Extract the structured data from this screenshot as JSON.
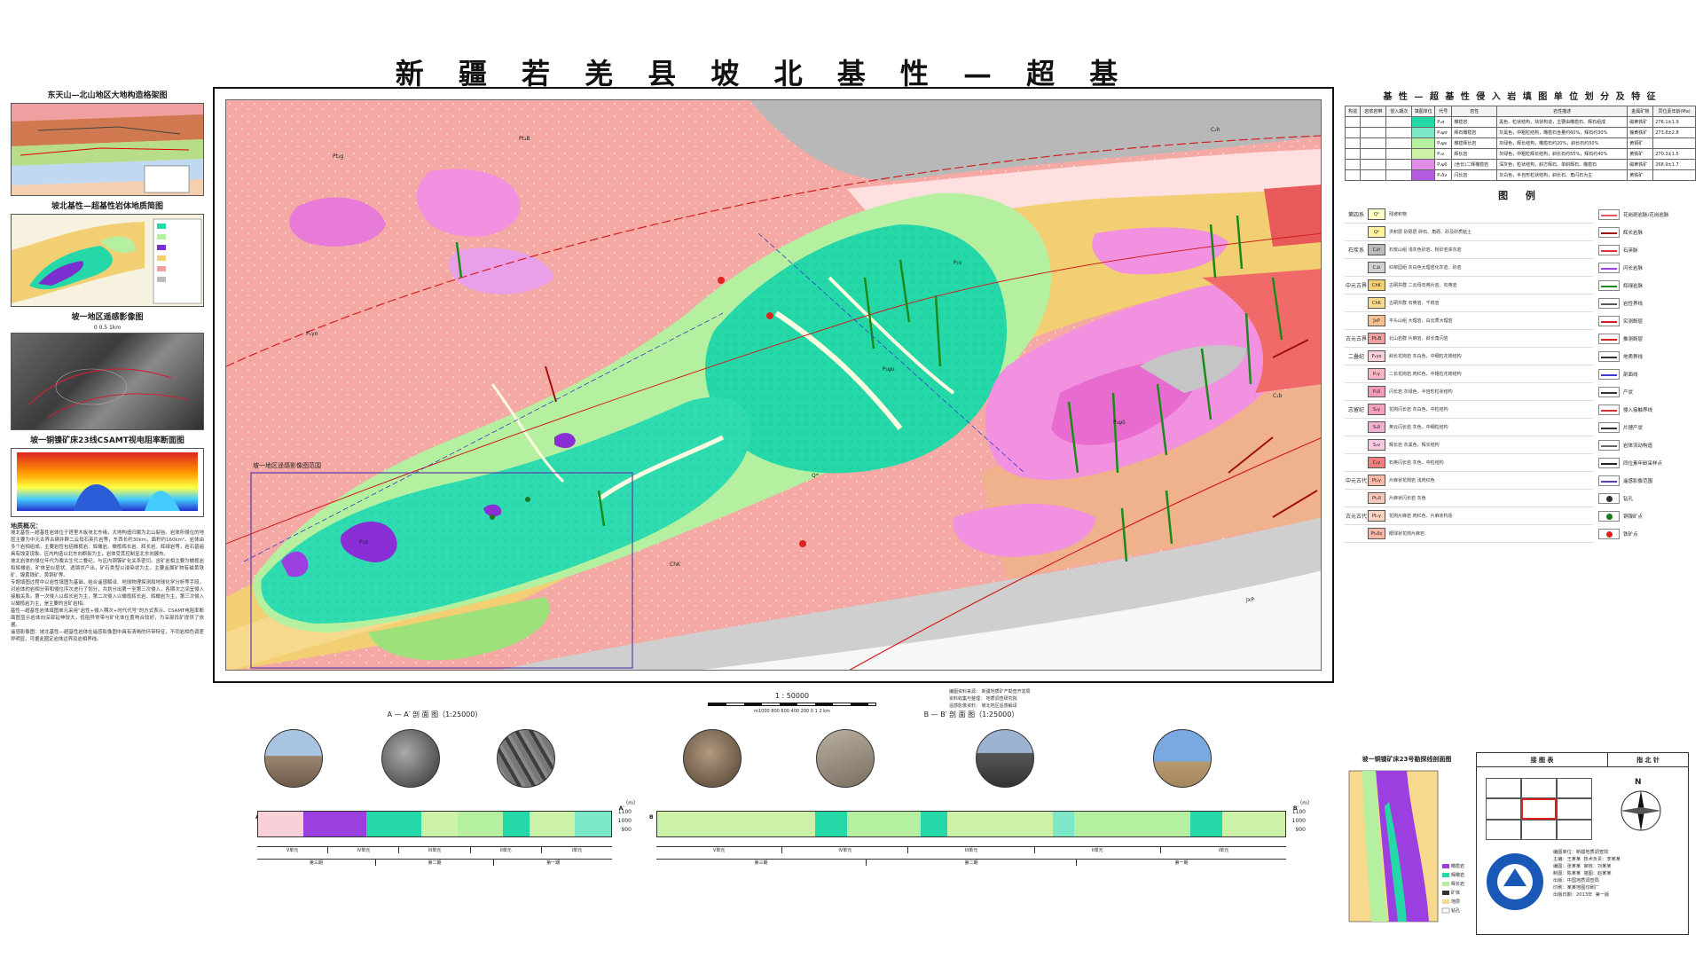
{
  "title": "新 疆 若 羌 县 坡 北 基 性 — 超 基 性 岩 体 地 质 图",
  "left": {
    "inset1_title": "东天山—北山地区大地构造格架图",
    "inset2_title": "坡北基性—超基性岩体地质简图",
    "inset3_title": "坡一地区遥感影像图",
    "inset3_scale": "0    0.5    1km",
    "inset4_title": "坡一铜镍矿床23线CSAMT视电阻率断面图",
    "notes_title": "地质概况：",
    "notes": "坡北基性—超基性岩体位于塔里木板块北东缘，大地构造归属为北山裂谷。岩体所侵位的地层主要为中元古界古硐井群二云母石英片岩等，东西长约30km，面积约160km²。岩体由多个岩相组成，主要岩性包括橄榄岩、辉橄岩、橄榄辉长岩、辉长岩、辉绿岩等，岩石普遍具有蚀变现象。区内构造以北东向断裂为主，岩体受其控制呈北东向展布。\n坡北岩体的侵位年代为晚古生代二叠纪，与区内铜镍矿化关系密切。含矿岩相主要为橄榄岩和辉橄岩，矿体呈似层状、透镜状产出，矿石类型以浸染状为主，主要金属矿物有磁黄铁矿、镍黄铁矿、黄铜矿等。\n专题填图过程中以岩性填图为基础，结合遥感解译、地球物理探测和地球化学分析等手段，对岩体的岩相分带和侵位序次进行了划分，共划分出第一至第三次侵入，各期次之间呈侵入接触关系。第一次侵入以辉长岩为主，第二次侵入以橄榄辉长岩、辉橄岩为主，第三次侵入以橄榄岩为主，是主要的含矿岩相。\n基性—超基性岩体填图单元采用“岩性+侵入期次+时代代号”的方式表示。CSAMT电阻率断面图显示岩体向深部延伸较大，低阻异常带与矿化体位置吻合较好，为深部找矿提供了依据。\n遥感影像图：坡北基性—超基性岩体在遥感影像图中具有清晰的环带特征，不同岩相色调差异明显，可据此圈定岩体边界及岩相界线。"
  },
  "map": {
    "rs_box_label": "坡一地区遥感影像图范围",
    "grid_left": [
      "",
      "",
      "",
      "",
      "",
      ""
    ],
    "labels": [
      {
        "t": "Pt₂g",
        "c": "#333"
      },
      {
        "t": "P₁γo",
        "c": "#333"
      },
      {
        "t": "C₂h",
        "c": "#333"
      },
      {
        "t": "Pt₁B",
        "c": "#333"
      },
      {
        "t": "ChK",
        "c": "#333"
      },
      {
        "t": "P₁ψδ",
        "c": "#333"
      },
      {
        "t": "P₁ψυ",
        "c": "#333"
      },
      {
        "t": "JxP",
        "c": "#333"
      },
      {
        "t": "Qᵃˡ",
        "c": "#333"
      },
      {
        "t": "C₁b",
        "c": "#333"
      },
      {
        "t": "P₁σ",
        "c": "#333"
      },
      {
        "t": "P₁ν",
        "c": "#333"
      }
    ]
  },
  "scale": {
    "ratio": "1 : 50000",
    "bar": "m1000  800  600  400  200    0              1               2 km"
  },
  "credits": [
    "编图资料来源：  新疆地质矿产勘查开发局",
    "资料收集与整理：  地质调查研究院",
    "遥感影像资料：  坡北地区遥感解译"
  ],
  "section_a": {
    "title": "A — A′ 剖 面 图（1:25000）",
    "left_mark": "A",
    "right_mark": "A′",
    "elev": [
      "1100",
      "1000",
      "900"
    ],
    "unit": "（m）",
    "bar_labels": [
      "V单元",
      "IV单元",
      "III单元",
      "II单元",
      "I单元",
      "第三期",
      "第二期",
      "第一期"
    ]
  },
  "section_b": {
    "title": "B — B′ 剖 面 图（1:25000）",
    "left_mark": "B",
    "right_mark": "B′",
    "elev": [
      "1100",
      "1000",
      "900"
    ],
    "unit": "（m）",
    "bar_labels": [
      "V单元",
      "IV单元",
      "III单元",
      "II单元",
      "I单元",
      "第三期",
      "第二期",
      "第一期"
    ]
  },
  "right": {
    "table_title": "基 性 — 超 基 性 侵 入 岩 填 图 单 位 划 分 及 特 征",
    "table_headers": [
      "构造",
      "岩浆岩带",
      "侵入期次",
      "填图单位",
      "代号",
      "岩性",
      "岩性描述",
      "金属矿物",
      "同位素年龄(Ma)"
    ],
    "table_rows": [
      {
        "code": "P₁σ",
        "rock": "橄榄岩",
        "desc": "黑色、粒状结构，块状构造，主要由橄榄石、辉石组成",
        "ore": "磁黄铁矿",
        "age": "276.1±1.9",
        "color": "#25d8a8"
      },
      {
        "code": "P₁ψσ",
        "rock": "辉石橄榄岩",
        "desc": "灰黑色，中粗粒结构，橄榄石含量约60%，辉石约30%",
        "ore": "镍黄铁矿",
        "age": "273.8±2.8",
        "color": "#7ce8c8"
      },
      {
        "code": "P₁ψυ",
        "rock": "橄榄辉长岩",
        "desc": "灰绿色，辉长结构，橄榄石约20%，斜长石约50%",
        "ore": "黄铜矿",
        "age": "",
        "color": "#b5f0a0"
      },
      {
        "code": "P₁ν",
        "rock": "辉长岩",
        "desc": "灰绿色，中粗粒辉长结构，斜长石约55%，辉石约40%",
        "ore": "黄铁矿",
        "age": "270.3±1.5",
        "color": "#ccf2a8"
      },
      {
        "code": "P₁ψδ",
        "rock": "(含长)二辉橄榄岩",
        "desc": "深灰色，粒状结构，斜方辉石、单斜辉石、橄榄石",
        "ore": "磁黄铁矿",
        "age": "268.9±1.7",
        "color": "#e18de8"
      },
      {
        "code": "P₁δν",
        "rock": "闪长岩",
        "desc": "灰白色，半自形粒状结构，斜长石、角闪石为主",
        "ore": "黄铁矿",
        "age": "",
        "color": "#b45ae0"
      }
    ],
    "legend_title": "图 例",
    "legend": [
      {
        "era": "第四系",
        "code": "Qʰ",
        "color": "#ffffc8",
        "txt": "残坡积物"
      },
      {
        "era": "",
        "code": "Qᵖ",
        "color": "#fff3a0",
        "txt": "洪积层 砂砾层 碎石、角砾、砂及砂质粘土"
      },
      {
        "era": "石炭系",
        "code": "C₂h",
        "color": "#bbbbbb",
        "txt": "石炭山组  浅灰色砂岩、粉砂岩夹灰岩"
      },
      {
        "era": "",
        "code": "C₁b",
        "color": "#d0d0d0",
        "txt": "红柳园组  灰白色大理岩化灰岩、砂岩"
      },
      {
        "era": "中元古界",
        "code": "ChK",
        "color": "#f2cf72",
        "txt": "古硐井群  二云母石英片岩、石英岩"
      },
      {
        "era": "",
        "code": "ChK",
        "color": "#f6d98c",
        "txt": "古硐井群 石英岩、千枚岩"
      },
      {
        "era": "",
        "code": "JxP",
        "color": "#f8c090",
        "txt": "平头山组 大理岩、白云质大理岩"
      },
      {
        "era": "古元古界",
        "code": "Pt₁B",
        "color": "#f0a0a0",
        "txt": "北山岩群  片麻岩、斜长角闪岩"
      },
      {
        "era": "二叠纪",
        "code": "P₁γo",
        "color": "#f9d0d8",
        "txt": "斜长花岗岩  灰白色，中细粒花岗结构"
      },
      {
        "era": "",
        "code": "P₁γ",
        "color": "#f6b4c4",
        "txt": "二长花岗岩  肉红色，中粗粒花岗结构"
      },
      {
        "era": "",
        "code": "P₁δ",
        "color": "#f39ab6",
        "txt": "闪长岩  灰绿色，半自形粒状结构"
      },
      {
        "era": "志留纪",
        "code": "S₃γ",
        "color": "#f5a0c0",
        "txt": "花岗闪长岩  灰白色，中粒结构"
      },
      {
        "era": "",
        "code": "S₃δ",
        "color": "#f2b0d0",
        "txt": "英云闪长岩  灰色，中细粒结构"
      },
      {
        "era": "",
        "code": "S₃ν",
        "color": "#f8c8e0",
        "txt": "辉长岩  灰黑色，辉长结构"
      },
      {
        "era": "",
        "code": "C₂γ",
        "color": "#f08080",
        "txt": "石英闪长岩  灰色，中粒结构"
      },
      {
        "era": "中元古代",
        "code": "Pt₂γ",
        "color": "#f9b8a8",
        "txt": "片麻状花岗岩  浅肉红色"
      },
      {
        "era": "",
        "code": "Pt₂δ",
        "color": "#f7c8b8",
        "txt": "片麻状闪长岩  灰色"
      },
      {
        "era": "古元古代",
        "code": "Pt₁γ",
        "color": "#fcd2c0",
        "txt": "花岗片麻岩  肉红色、片麻状构造"
      },
      {
        "era": "",
        "code": "Pt₁δγ",
        "color": "#f8b8a8",
        "txt": "眼球状花岗片麻岩"
      }
    ],
    "symbols": [
      "花岗斑岩脉/花岗岩脉",
      "辉长岩脉",
      "石英脉",
      "闪长岩脉",
      "辉绿岩脉",
      "岩性界线",
      "实测断层",
      "推测断层",
      "地质界线",
      "剖面线",
      "产状",
      "侵入接触界线",
      "片理产状",
      "岩体流动构造",
      "同位素年龄采样点",
      "遥感影像范围",
      "钻孔",
      "铜镍矿点",
      "铁矿点"
    ],
    "drill_title": "坡一铜镍矿床23号勘探线剖面图",
    "index_title": "接 图 表",
    "north_title": "指 北 针",
    "north_n": "N",
    "drill_legend": [
      "橄榄岩",
      "辉橄岩",
      "辉长岩",
      "矿体",
      "地层",
      "钻孔"
    ],
    "credits2": "编图单位：新疆地质调查院\n主编：王某某  技术负责：李某某\n编图：张某某  审核：刘某某\n制图：陈某某  描图：赵某某\n出版：中国地质调查局\n印刷：某某地图印刷厂\n出版日期：2013年  第一版"
  }
}
